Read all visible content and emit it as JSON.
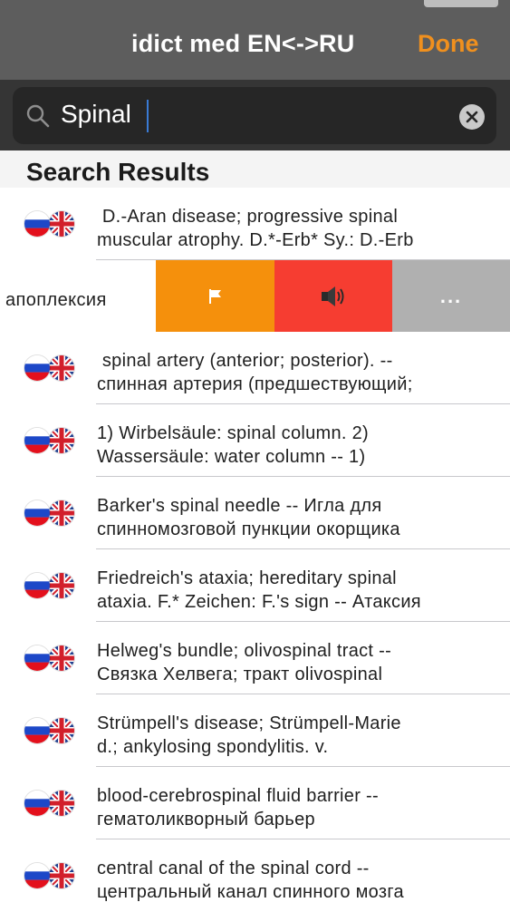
{
  "header": {
    "title": "idict med EN<->RU",
    "done_label": "Done"
  },
  "search": {
    "value": "Spinal"
  },
  "section": {
    "title": "Search Results"
  },
  "swipe": {
    "visible_text": "апоплексия",
    "actions": [
      "flag-icon",
      "speaker-icon",
      "more-icon"
    ],
    "more_label": "...",
    "colors": {
      "flag": "#f5900c",
      "sound": "#f63d31",
      "more": "#b0b0b0"
    }
  },
  "results": [
    {
      "line1": " D.-Aran disease; progressive spinal",
      "line2": "muscular atrophy. D.*-Erb* Sy.: D.-Erb"
    },
    {
      "line1": " spinal artery (anterior; posterior). --",
      "line2": "спинная артерия (предшествующий;"
    },
    {
      "line1": "1) Wirbelsäule: spinal column. 2)",
      "line2": "Wassersäule: water column -- 1)"
    },
    {
      "line1": "Barker's spinal needle -- Игла для",
      "line2": "спинномозговой пункции окорщика"
    },
    {
      "line1": "Friedreich's ataxia; hereditary spinal",
      "line2": "ataxia. F.* Zeichen: F.'s sign -- Атаксия"
    },
    {
      "line1": "Helweg's bundle; olivospinal tract --",
      "line2": "Связка Хелвега; тракт olivospinal"
    },
    {
      "line1": "Strümpell's disease; Strümpell-Marie",
      "line2": "d.; ankylosing spondylitis. v."
    },
    {
      "line1": "blood-cerebrospinal fluid barrier --",
      "line2": "гематоликворный барьер"
    },
    {
      "line1": "central canal of the spinal cord --",
      "line2": "центральный канал спинного мозга"
    }
  ],
  "colors": {
    "accent": "#f0901e",
    "navbar": "#5d5d5d",
    "search_bar": "#353535"
  }
}
